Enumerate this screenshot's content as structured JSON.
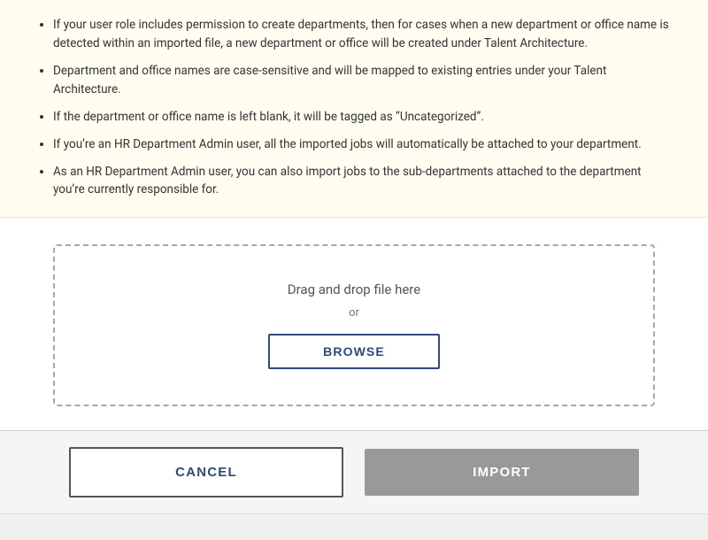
{
  "info": {
    "bullets": [
      "If your user role includes permission to create departments, then for cases when a new department or office name is detected within an imported file, a new department or office will be created under Talent Architecture.",
      "Department and office names are case-sensitive and will be mapped to existing entries under your Talent Architecture.",
      "If the department or office name is left blank, it will be tagged as “Uncategorized”.",
      "If you’re an HR Department Admin user, all the imported jobs will automatically be attached to your department.",
      "As an HR Department Admin user, you can also import jobs to the sub-departments attached to the department you’re currently responsible for."
    ]
  },
  "dropzone": {
    "drag_text": "Drag and drop file here",
    "or_text": "or",
    "browse_label": "BROWSE"
  },
  "footer": {
    "cancel_label": "CANCEL",
    "import_label": "IMPORT"
  }
}
